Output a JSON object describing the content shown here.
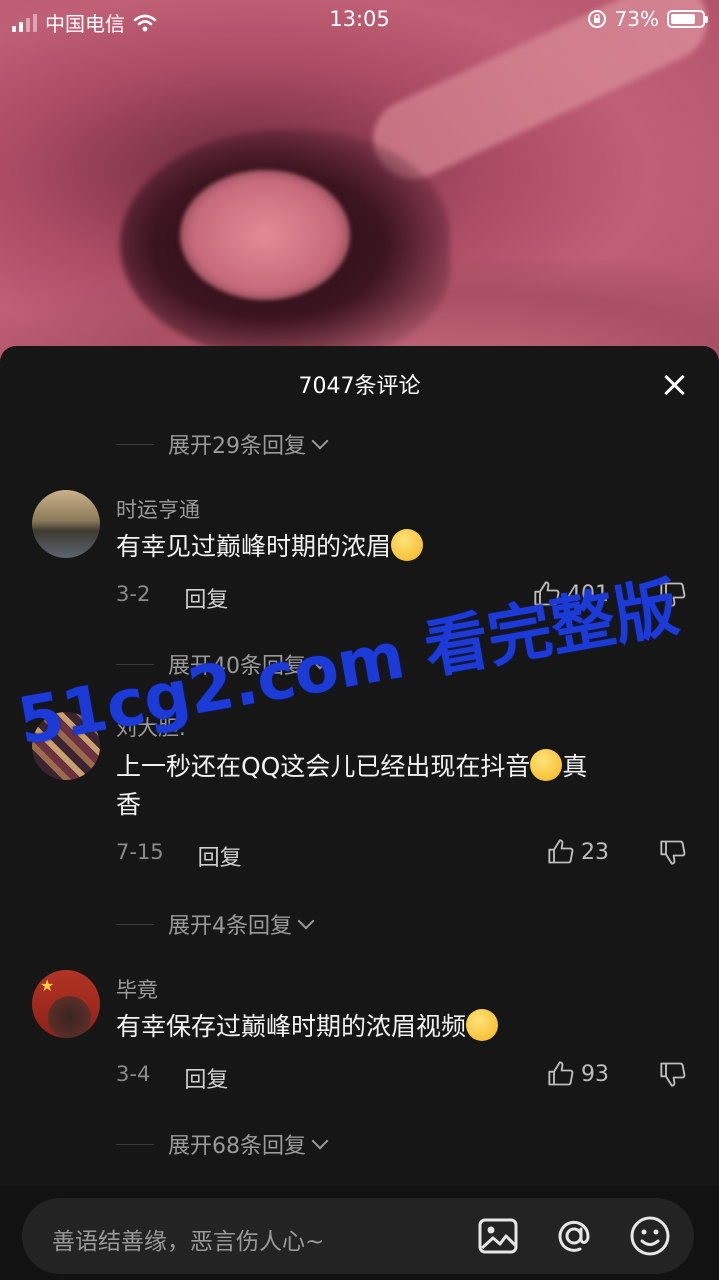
{
  "status_bar": {
    "carrier": "中国电信",
    "time": "13:05",
    "battery": "73%"
  },
  "sheet": {
    "title": "7047条评论"
  },
  "threads": [
    {
      "expand": "展开29条回复"
    },
    {
      "expand": "展开40条回复"
    },
    {
      "expand": "展开4条回复"
    },
    {
      "expand": "展开68条回复"
    }
  ],
  "comments": [
    {
      "name": "时运亨通",
      "text": "有幸见过巅峰时期的浓眉",
      "date": "3-2",
      "reply": "回复",
      "likes": "401"
    },
    {
      "name": "刘大胆.",
      "text": "上一秒还在QQ这会儿已经出现在抖音",
      "text_tail": "真",
      "text_line2": "香",
      "date": "7-15",
      "reply": "回复",
      "likes": "23"
    },
    {
      "name": "毕竟",
      "text": "有幸保存过巅峰时期的浓眉视频",
      "date": "3-4",
      "reply": "回复",
      "likes": "93"
    }
  ],
  "input": {
    "placeholder": "善语结善缘，恶言伤人心~"
  },
  "watermark": {
    "text": "51cg2.com 看完整版"
  }
}
